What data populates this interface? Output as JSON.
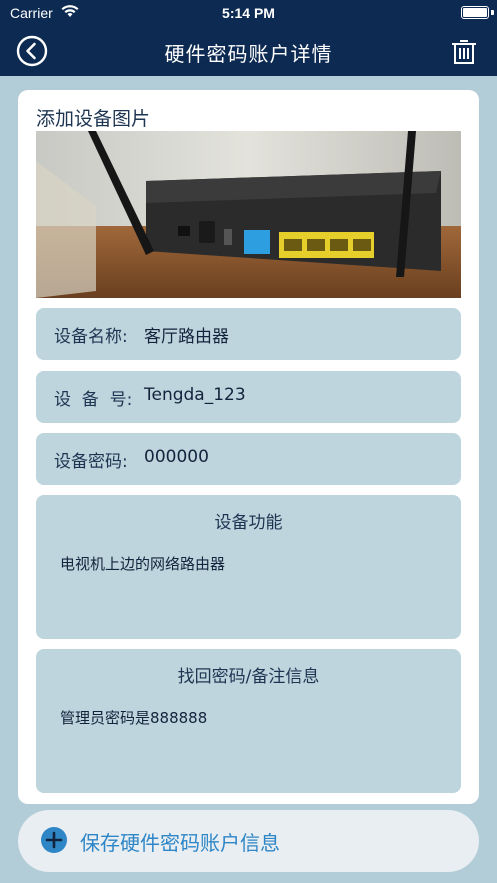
{
  "status_bar": {
    "carrier": "Carrier",
    "time": "5:14 PM",
    "wifi_icon": "wifi-icon",
    "battery_icon": "battery-icon"
  },
  "nav": {
    "title": "硬件密码账户详情",
    "back_icon": "back-circle-icon",
    "trash_icon": "trash-icon"
  },
  "device": {
    "add_photo_label": "添加设备图片",
    "name_label": "设备名称:",
    "name_value": "客厅路由器",
    "number_label": "设  备  号:",
    "number_value": "Tengda_123",
    "password_label": "设备密码:",
    "password_value": "000000",
    "function_heading": "设备功能",
    "function_text": "电视机上边的网络路由器",
    "recovery_heading": "找回密码/备注信息",
    "recovery_text": "管理员密码是888888"
  },
  "save_button": {
    "label": "保存硬件密码账户信息",
    "icon": "plus-circle-icon"
  },
  "colors": {
    "nav_bg": "#0c2a52",
    "page_bg": "#b3cdd8",
    "field_bg": "#bed5de",
    "accent": "#2f86c7"
  }
}
